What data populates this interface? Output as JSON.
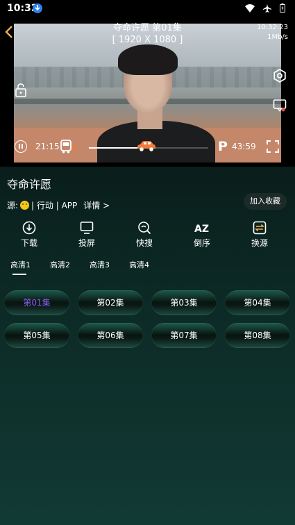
{
  "status_bar": {
    "time": "10:32",
    "icons": [
      "download-badge-icon",
      "wifi-icon",
      "airplane-icon",
      "battery-icon"
    ]
  },
  "player": {
    "title": "夺命许愿 第01集",
    "resolution": "[ 1920 X 1080 ]",
    "clock": "10:32:23",
    "speed": "1Mb/s",
    "current_time": "21:15",
    "total_time": "43:59",
    "progress": 0.48,
    "park_label": "P"
  },
  "info": {
    "show_title": "夺命许愿",
    "source_prefix": "源:",
    "genre": "| 行动 | APP",
    "details": "详情 >",
    "favorite": "加入收藏"
  },
  "actions": [
    {
      "label": "下载",
      "icon": "download-icon"
    },
    {
      "label": "投屏",
      "icon": "cast-icon"
    },
    {
      "label": "快搜",
      "icon": "search-icon"
    },
    {
      "label": "倒序",
      "icon": "sort-az-icon"
    },
    {
      "label": "换源",
      "icon": "switch-source-icon"
    }
  ],
  "quality_tabs": [
    "高清1",
    "高清2",
    "高清3",
    "高清4"
  ],
  "active_quality": 0,
  "episodes": [
    "第01集",
    "第02集",
    "第03集",
    "第04集",
    "第05集",
    "第06集",
    "第07集",
    "第08集"
  ],
  "active_episode": 0,
  "colors": {
    "accent": "#8a5cf5",
    "progress": "#ffffff"
  }
}
